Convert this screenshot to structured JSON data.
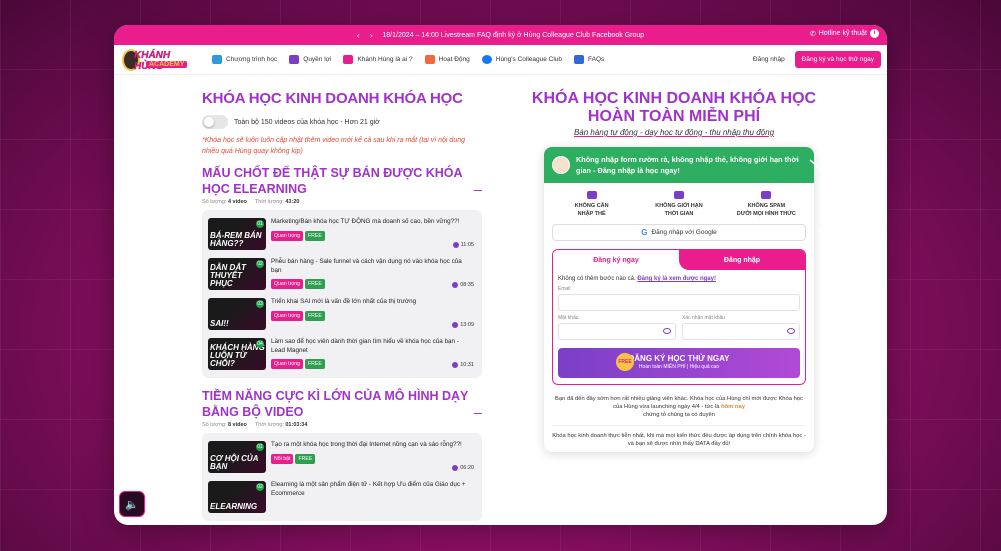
{
  "topbar": {
    "announcement": "18/1/2024 – 14:00 Livestream FAQ định kỳ ở Hùng Colleague Club Facebook Group",
    "hotline": "Hotline kỹ thuật",
    "arrows": "‹ ›"
  },
  "logo": {
    "name": "KHÁNH HÙNG",
    "sub": "ACADEMY"
  },
  "nav": {
    "items": [
      {
        "label": "Chương trình học",
        "color": "#2f9bd6"
      },
      {
        "label": "Quyền lợi",
        "color": "#7b3fc6"
      },
      {
        "label": "Khánh Hùng là ai ?",
        "color": "#e91e8c"
      },
      {
        "label": "Hoạt Động",
        "color": "#f0683b"
      },
      {
        "label": "Hùng's Colleague Club",
        "color": "#1877f2"
      },
      {
        "label": "FAQs",
        "color": "#2f6bd6"
      }
    ],
    "login": "Đăng nhập",
    "trial": "Đăng ký và học thử ngay"
  },
  "left": {
    "heading": "KHÓA HỌC KINH DOANH KHÓA HỌC",
    "toggle_label": "Toàn bộ 150 videos của khóa học - Hơn 21 giờ",
    "note": "*Khóa học sẽ luôn luôn cập nhật thêm video mới kể cả sau khi ra mắt (tại vì nội dung nhiều quá Hùng quay không kịp)",
    "sections": [
      {
        "title": "MẤU CHỐT ĐỂ THẬT SỰ BÁN ĐƯỢC KHÓA HỌC ELEARNING",
        "count_label": "Số lượng:",
        "count": "4 video",
        "time_label": "Thời lượng:",
        "time": "43:20",
        "lessons": [
          {
            "num": "01",
            "thumb": "BÁ-REM BÁN HÀNG??",
            "title": "Marketing/Bán khóa học TỰ ĐỘNG mà doanh số cao, bền vững??!",
            "tag1": "Quan trọng",
            "tag2": "FREE",
            "duration": "11:05"
          },
          {
            "num": "02",
            "thumb": "DẪN DẮT THUYẾT PHỤC",
            "title": "Phễu bán hàng - Sale funnel và cách vận dụng nó vào khóa học của bạn",
            "tag1": "Quan trọng",
            "tag2": "FREE",
            "duration": "08:35"
          },
          {
            "num": "03",
            "thumb": "SAI!!",
            "title": "Triển khai SAI mới là vấn đề lớn nhất của thị trường",
            "tag1": "Quan trọng",
            "tag2": "FREE",
            "duration": "13:09"
          },
          {
            "num": "04",
            "thumb": "KHÁCH HÀNG LUÔN TỪ CHỐI?",
            "title": "Làm sao để học viên dành thời gian tìm hiểu về khóa học của bạn - Lead Magnet",
            "tag1": "Quan trọng",
            "tag2": "FREE",
            "duration": "10:31"
          }
        ]
      },
      {
        "title": "TIỀM NĂNG CỰC KÌ LỚN CỦA MÔ HÌNH DẠY BẰNG BỘ VIDEO",
        "count_label": "Số lượng:",
        "count": "8 video",
        "time_label": "Thời lượng:",
        "time": "01:03:34",
        "lessons": [
          {
            "num": "01",
            "thumb": "CƠ HỘI CỦA BẠN",
            "title": "Tạo ra một khóa học trong thời đại Internet nồng cạn và sáo rỗng??!",
            "tag1": "Nổi bật",
            "tag2": "FREE",
            "duration": "06:20"
          },
          {
            "num": "02",
            "thumb": "ELEARNING",
            "title": "Elearning là một sản phẩm điện tử - Kết hợp Ưu điểm của Giáo dục + Ecommerce",
            "tag1": "",
            "tag2": "",
            "duration": ""
          }
        ]
      }
    ]
  },
  "right": {
    "title": "KHÓA HỌC KINH DOANH KHÓA HỌC HOÀN TOÀN MIỄN PHÍ",
    "subtitle": "Bán hàng tự động - dạy học tự động - thu nhập thụ động",
    "card_head": "Không nhập form rườm rà, không nhập thẻ, không giới hạn thời gian - Đăng nhập là học ngay!",
    "features": [
      {
        "line1": "KHÔNG CẦN",
        "line2": "NHẬP THẺ"
      },
      {
        "line1": "KHÔNG GIỚI HẠN",
        "line2": "THỜI GIAN"
      },
      {
        "line1": "KHÔNG SPAM",
        "line2": "DƯỚI MỌI HÌNH THỨC"
      }
    ],
    "google": "Đăng nhập với Google",
    "tab_register": "Đăng ký ngay",
    "tab_login": "Đăng nhập",
    "hint": "Không có thêm bước nào cả.",
    "hint_link": "Đăng ký là xem được ngay!",
    "email_label": "Email",
    "password_label": "Mật khẩu",
    "confirm_label": "Xác nhận mật khẩu",
    "badge": "FREE",
    "cta": "ĐĂNG KÝ HỌC THỬ NGAY",
    "cta_sub": "Hoàn toàn MIỄN PHÍ | Hiệu quả cao",
    "note1": "Bạn đã đến đây sớm hơn rất nhiều giảng viên khác. Khóa học của Hùng chỉ mới được Khóa học của Hùng vừa launching ngày 4/4 - tức là",
    "note1_hl": "hôm nay",
    "note1_end": "chứng tỏ chúng ta có duyên",
    "note2": "Khóa học kinh doanh thực tiễn nhất, khi mà mọi kiến thức đều được áp dụng trên chính khóa học - và bạn sẽ được nhìn thấy DATA đầy đủ!"
  }
}
